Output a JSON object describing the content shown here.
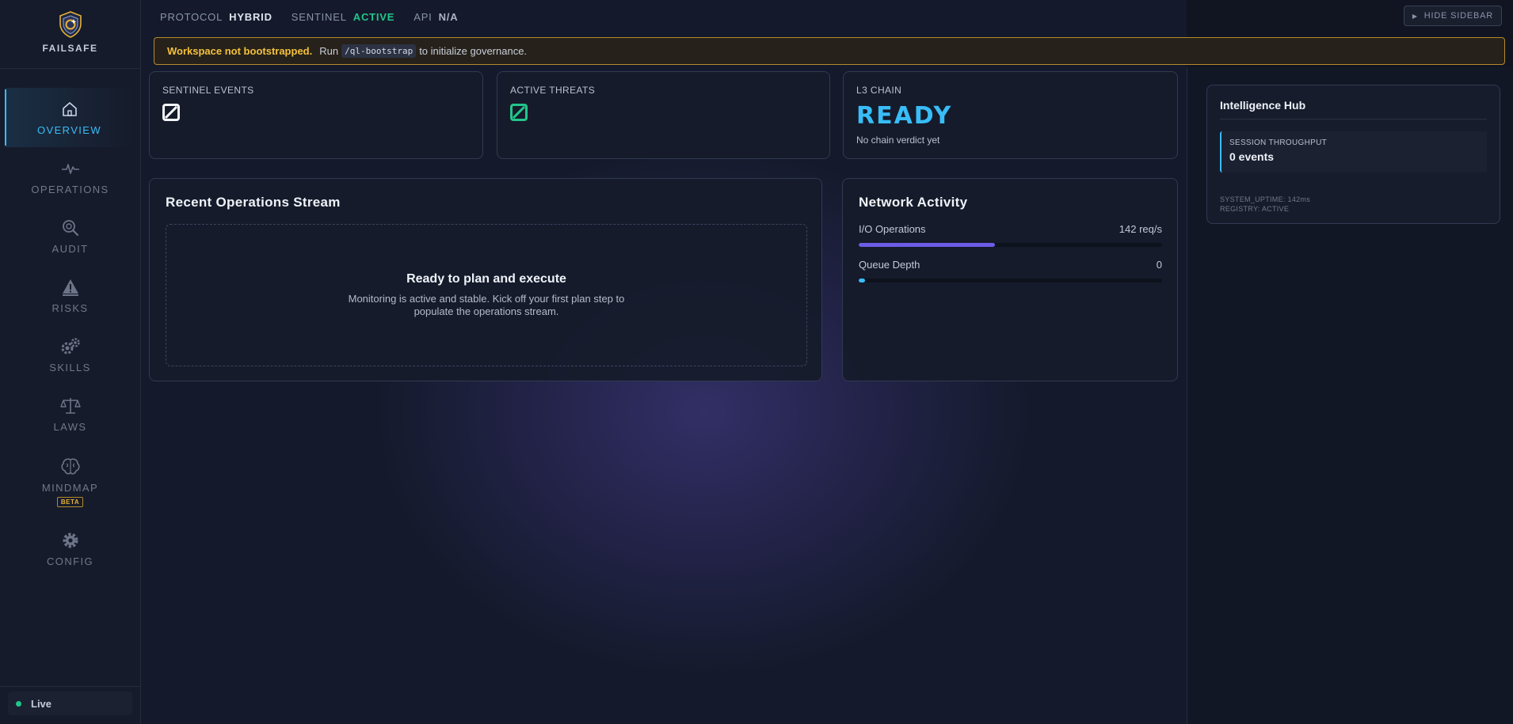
{
  "brand": {
    "name": "FAILSAFE",
    "logo_icon": "shield-icon"
  },
  "sidebar": {
    "items": [
      {
        "label": "OVERVIEW",
        "icon": "home-icon",
        "active": true
      },
      {
        "label": "OPERATIONS",
        "icon": "pulse-icon"
      },
      {
        "label": "AUDIT",
        "icon": "magnifier-icon"
      },
      {
        "label": "RISKS",
        "icon": "warning-icon"
      },
      {
        "label": "SKILLS",
        "icon": "gears-icon"
      },
      {
        "label": "LAWS",
        "icon": "scales-icon"
      },
      {
        "label": "MINDMAP",
        "icon": "brain-icon",
        "badge": "BETA"
      },
      {
        "label": "CONFIG",
        "icon": "gear-icon"
      }
    ],
    "status": {
      "label": "Live",
      "color": "#22c58b"
    }
  },
  "topbar": {
    "protocol": {
      "key": "PROTOCOL",
      "value": "HYBRID"
    },
    "sentinel": {
      "key": "SENTINEL",
      "value": "ACTIVE"
    },
    "api": {
      "key": "API",
      "value": "N/A"
    },
    "hide_sidebar": "HIDE SIDEBAR"
  },
  "banner": {
    "strong": "Workspace not bootstrapped.",
    "pre": "Run",
    "command": "/ql-bootstrap",
    "post": "to initialize governance."
  },
  "stats": {
    "sentinel_events": {
      "label": "SENTINEL EVENTS",
      "value": "0"
    },
    "active_threats": {
      "label": "ACTIVE THREATS",
      "value": "0",
      "color": "#22c58b"
    },
    "l3_chain": {
      "label": "L3 CHAIN",
      "value": "READY",
      "sub": "No chain verdict yet",
      "color": "#38bdf8"
    }
  },
  "operations": {
    "title": "Recent Operations Stream",
    "empty_title": "Ready to plan and execute",
    "empty_text": "Monitoring is active and stable. Kick off your first plan step to populate the operations stream."
  },
  "network": {
    "title": "Network Activity",
    "metrics": [
      {
        "label": "I/O Operations",
        "value": "142 req/s",
        "fraction": 0.45,
        "color": "#6d5ce8"
      },
      {
        "label": "Queue Depth",
        "value": "0",
        "fraction": 0.02,
        "color": "#38bdf8"
      }
    ]
  },
  "hub": {
    "title": "Intelligence Hub",
    "throughput_label": "SESSION THROUGHPUT",
    "throughput_value": "0 events",
    "uptime": "SYSTEM_UPTIME: 142ms",
    "registry": "REGISTRY: ACTIVE"
  }
}
